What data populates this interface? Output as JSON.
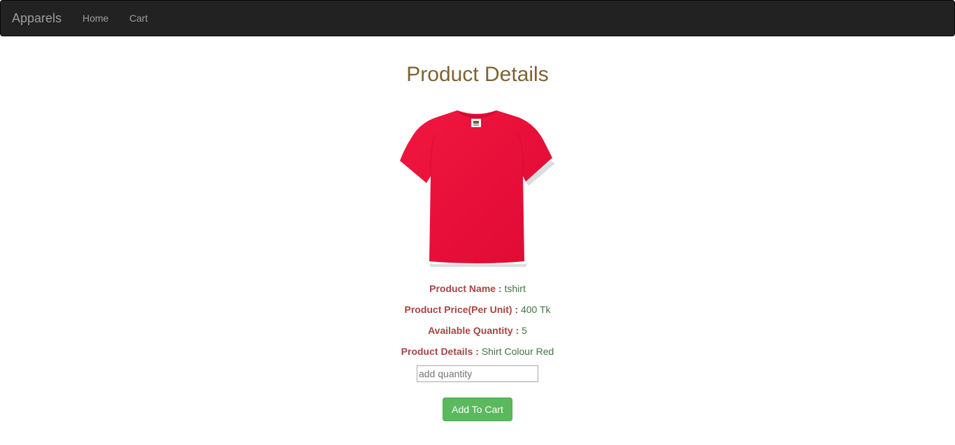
{
  "navbar": {
    "brand": "Apparels",
    "links": [
      {
        "label": "Home"
      },
      {
        "label": "Cart"
      }
    ]
  },
  "page": {
    "title": "Product Details"
  },
  "product": {
    "image_icon": "red-tshirt-image",
    "accent_color": "#ee1038",
    "details": [
      {
        "label": "Product Name :",
        "value": "tshirt"
      },
      {
        "label": "Product Price(Per Unit) :",
        "value": "400 Tk"
      },
      {
        "label": "Available Quantity :",
        "value": "5"
      },
      {
        "label": "Product Details :",
        "value": "Shirt Colour Red"
      }
    ]
  },
  "form": {
    "quantity_placeholder": "add quantity",
    "quantity_value": "",
    "submit_label": "Add To Cart"
  },
  "colors": {
    "navbar_bg": "#222222",
    "title": "#7d6331",
    "label": "#a94442",
    "value": "#3c763d",
    "button": "#5cb85c"
  }
}
